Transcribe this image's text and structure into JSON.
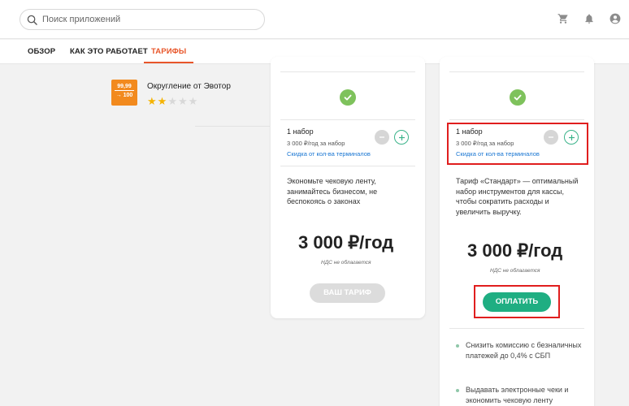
{
  "search": {
    "placeholder": "Поиск приложений"
  },
  "tabs": [
    {
      "label": "ОБЗОР"
    },
    {
      "label": "КАК ЭТО РАБОТАЕТ"
    },
    {
      "label": "ТАРИФЫ",
      "active": true
    }
  ],
  "app": {
    "logo_top": "99,99",
    "logo_bottom": "→ 100",
    "name": "Округление от Эвотор",
    "rating": 2,
    "rating_max": 5
  },
  "cards": [
    {
      "set_title": "1 набор",
      "set_price": "3 000 ₽/год за набор",
      "discount_link": "Скидка от кол-ва терминалов",
      "description": "Экономьте чековую ленту, занимайтесь бизнесом, не беспокоясь о законах",
      "price": "3 000 ₽/год",
      "vat": "НДС не облагается",
      "button": "ВАШ ТАРИФ"
    },
    {
      "set_title": "1 набор",
      "set_price": "3 000 ₽/год за набор",
      "discount_link": "Скидка от кол-ва терминалов",
      "description": "Тариф «Стандарт» — оптимальный набор инструментов для кассы, чтобы сократить расходы и увеличить выручку.",
      "price": "3 000 ₽/год",
      "vat": "НДС не облагается",
      "button": "ОПЛАТИТЬ",
      "features": [
        "Снизить комиссию с безналичных платежей до 0,4% с СБП",
        "Выдавать электронные чеки и экономить чековую ленту"
      ]
    }
  ],
  "colors": {
    "accent": "#e8562a",
    "pay_button": "#1fae82",
    "check": "#7ec25c",
    "link": "#1976d2",
    "highlight": "#e01e1e"
  },
  "icons": [
    "search-icon",
    "cart-icon",
    "bell-icon",
    "user-icon",
    "check-icon",
    "minus-icon",
    "plus-icon"
  ]
}
